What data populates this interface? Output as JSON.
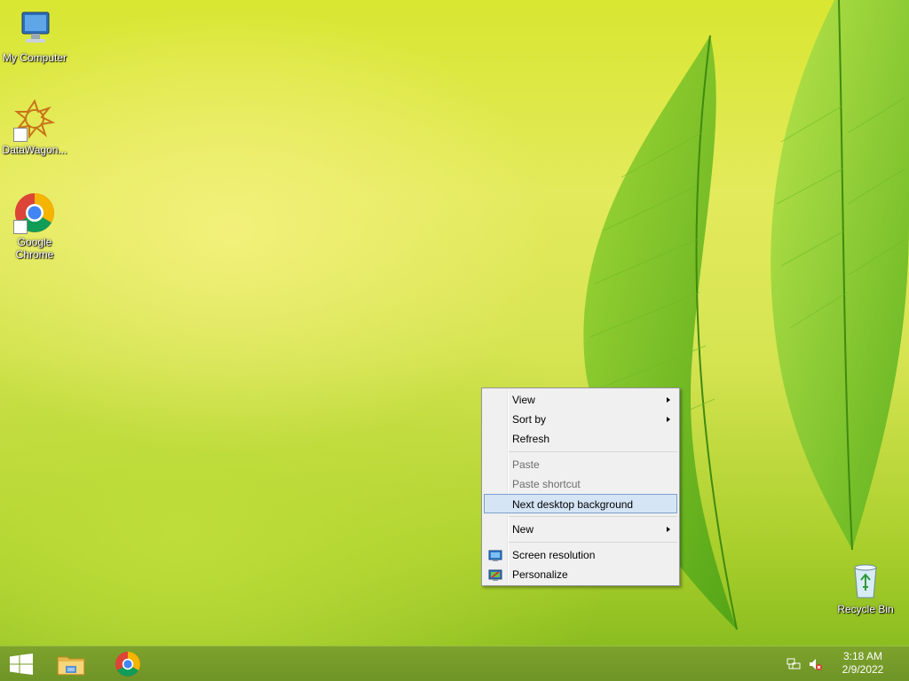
{
  "desktop": {
    "icons": [
      {
        "label_line1": "My Computer",
        "label_line2": "",
        "icon": "computer-icon"
      },
      {
        "label_line1": "DataWagon...",
        "label_line2": "",
        "icon": "datawagon-icon"
      },
      {
        "label_line1": "Google",
        "label_line2": "Chrome",
        "icon": "chrome-icon"
      }
    ],
    "recycle_bin": {
      "label": "Recycle Bin",
      "icon": "recycle-bin-icon"
    }
  },
  "context_menu": {
    "view": "View",
    "sort_by": "Sort by",
    "refresh": "Refresh",
    "paste": "Paste",
    "paste_shortcut": "Paste shortcut",
    "next_background": "Next desktop background",
    "new": "New",
    "screen_resolution": "Screen resolution",
    "personalize": "Personalize"
  },
  "taskbar": {
    "start": "start-icon",
    "pinned": [
      "file-explorer-icon",
      "chrome-icon"
    ],
    "tray": {
      "network": "network-icon",
      "volume": "volume-muted-icon",
      "time": "3:18 AM",
      "date": "2/9/2022"
    }
  },
  "colors": {
    "taskbar": "#7da22c",
    "menu_highlight": "#d5e5f6",
    "menu_highlight_border": "#7da2ce"
  }
}
